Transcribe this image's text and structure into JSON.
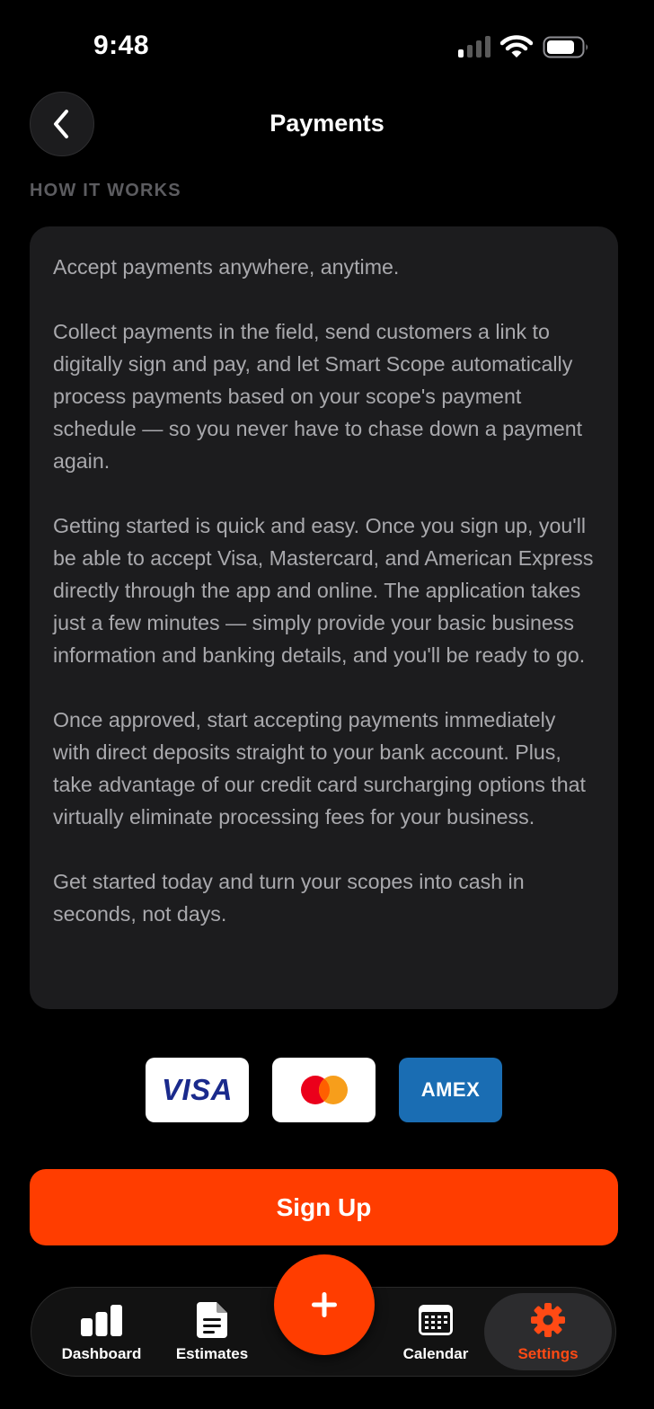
{
  "status_bar": {
    "time": "9:48"
  },
  "header": {
    "title": "Payments"
  },
  "section": {
    "header": "HOW IT WORKS"
  },
  "info_card": {
    "paragraphs": [
      "Accept payments anywhere, anytime.",
      "Collect payments in the field, send customers a link to digitally sign and pay, and let Smart Scope automatically process payments based on your scope's payment schedule — so you never have to chase down a payment again.",
      "Getting started is quick and easy. Once you sign up, you'll be able to accept Visa, Mastercard, and American Express directly through the app and online. The application takes just a few minutes — simply provide your basic business information and banking details, and you'll be ready to go.",
      "Once approved, start accepting payments immediately with direct deposits straight to your bank account. Plus, take advantage of our credit card surcharging options that virtually eliminate processing fees for your business.",
      "Get started today and turn your scopes into cash in seconds, not days."
    ]
  },
  "card_logos": {
    "visa": "VISA",
    "amex": "AMEX"
  },
  "signup_button": {
    "label": "Sign Up"
  },
  "tab_bar": {
    "tabs": [
      {
        "label": "Dashboard",
        "icon": "bar-chart-icon"
      },
      {
        "label": "Estimates",
        "icon": "document-icon"
      },
      {
        "label": "Calendar",
        "icon": "calendar-icon"
      },
      {
        "label": "Settings",
        "icon": "gear-icon",
        "active": true
      }
    ],
    "fab_icon": "plus-icon"
  },
  "colors": {
    "accent": "#ff3d00",
    "background": "#000000",
    "card_background": "#1c1c1e",
    "body_text": "#a9a9ad",
    "section_header": "#5c5c60",
    "active_tab": "#ff4a14",
    "amex_blue": "#1a6db3",
    "visa_blue": "#1a2a8c"
  }
}
